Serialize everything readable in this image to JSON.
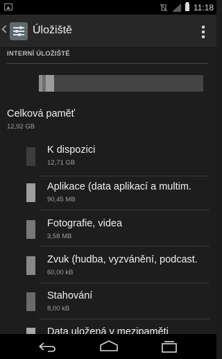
{
  "status_bar": {
    "time": "11:18",
    "icons": [
      "picture-icon",
      "vibrate-icon",
      "signal-icon",
      "battery-icon"
    ]
  },
  "action_bar": {
    "title": "Úložiště",
    "icons": [
      "back-caret-icon",
      "storage-settings-icon",
      "overflow-menu-icon"
    ]
  },
  "section": {
    "header": "INTERNÍ ÚLOŽIŠTĚ",
    "usage_bar": {
      "segments": [
        {
          "name": "Aplikace",
          "fraction": 0.02,
          "color": "#8e8e8e"
        },
        {
          "name": "Fotografie, videa",
          "fraction": 0.02,
          "color": "#6e6e6e"
        },
        {
          "name": "Zvuk",
          "fraction": 0.05,
          "color": "#9c9c9c"
        },
        {
          "name": "K dispozici",
          "fraction": 0.91,
          "color": "#444444"
        }
      ]
    }
  },
  "total": {
    "label": "Celková paměť",
    "value": "12,92 GB"
  },
  "items": [
    {
      "name": "K dispozici",
      "value": "12,71 GB",
      "color": "#3c3c3c"
    },
    {
      "name": "Aplikace (data aplikací a multim.",
      "value": "90,45 MB",
      "color": "#9e9e9e"
    },
    {
      "name": "Fotografie, videa",
      "value": "3,58 MB",
      "color": "#787878"
    },
    {
      "name": "Zvuk (hudba, vyzvánění, podcast.",
      "value": "60,00 kB",
      "color": "#888888"
    },
    {
      "name": "Stahování",
      "value": "8,00 kB",
      "color": "#6a6a6a"
    },
    {
      "name": "Data uložená v mezipaměti",
      "value": "",
      "color": "#a8a8a8"
    }
  ],
  "nav_bar": {
    "icons": [
      "back-icon",
      "home-icon",
      "recent-apps-icon"
    ]
  }
}
